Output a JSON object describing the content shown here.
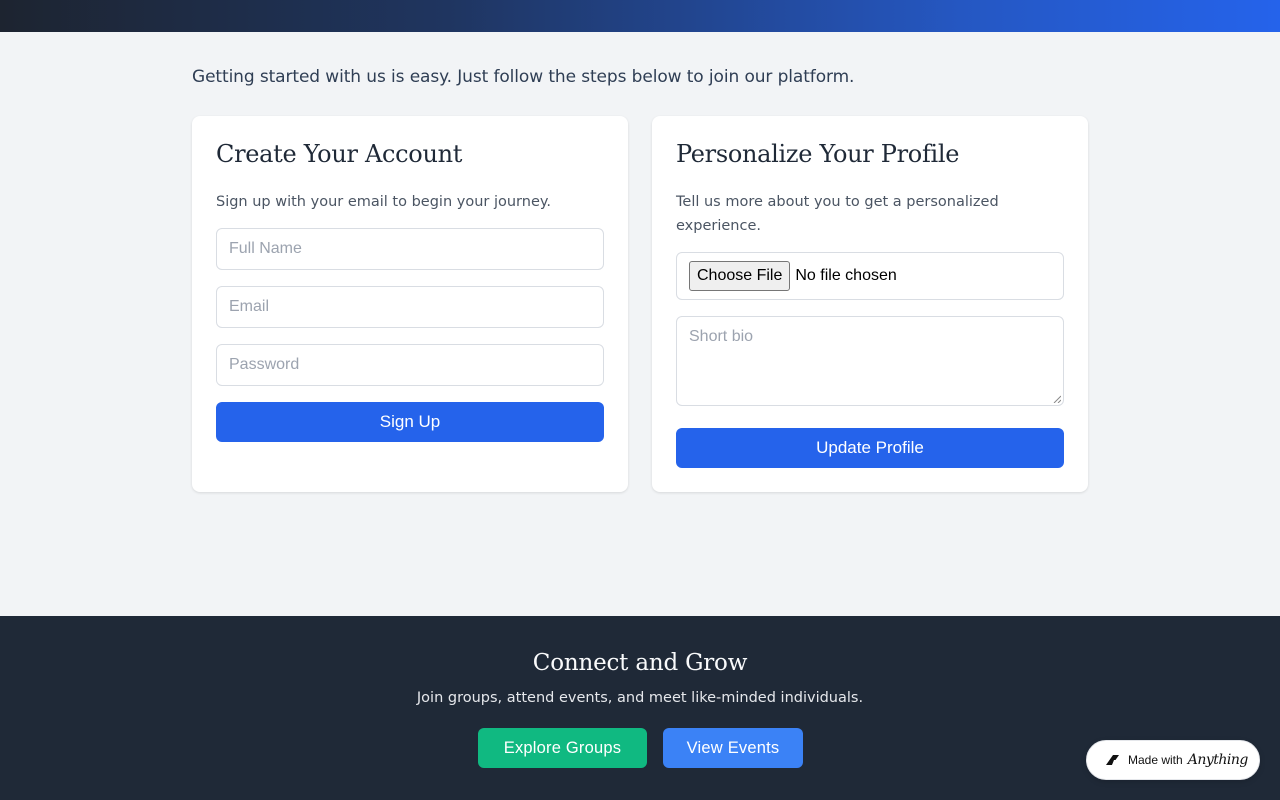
{
  "intro_text": "Getting started with us is easy. Just follow the steps below to join our platform.",
  "create_account": {
    "title": "Create Your Account",
    "subtitle": "Sign up with your email to begin your journey.",
    "full_name_placeholder": "Full Name",
    "email_placeholder": "Email",
    "password_placeholder": "Password",
    "submit_label": "Sign Up"
  },
  "personalize": {
    "title": "Personalize Your Profile",
    "subtitle": "Tell us more about you to get a personalized experience.",
    "file_button_label": "Choose File",
    "file_status": "No file chosen",
    "bio_placeholder": "Short bio",
    "submit_label": "Update Profile"
  },
  "footer": {
    "heading": "Connect and Grow",
    "tagline": "Join groups, attend events, and meet like-minded individuals.",
    "explore_label": "Explore Groups",
    "events_label": "View Events"
  },
  "badge": {
    "prefix": "Made with",
    "brand": "Anything",
    "icon": "anything-logo-icon"
  },
  "colors": {
    "primary": "#2563eb",
    "green": "#10b981",
    "blue": "#3b82f6",
    "footer_bg": "#1f2937",
    "page_bg": "#f2f4f6"
  }
}
